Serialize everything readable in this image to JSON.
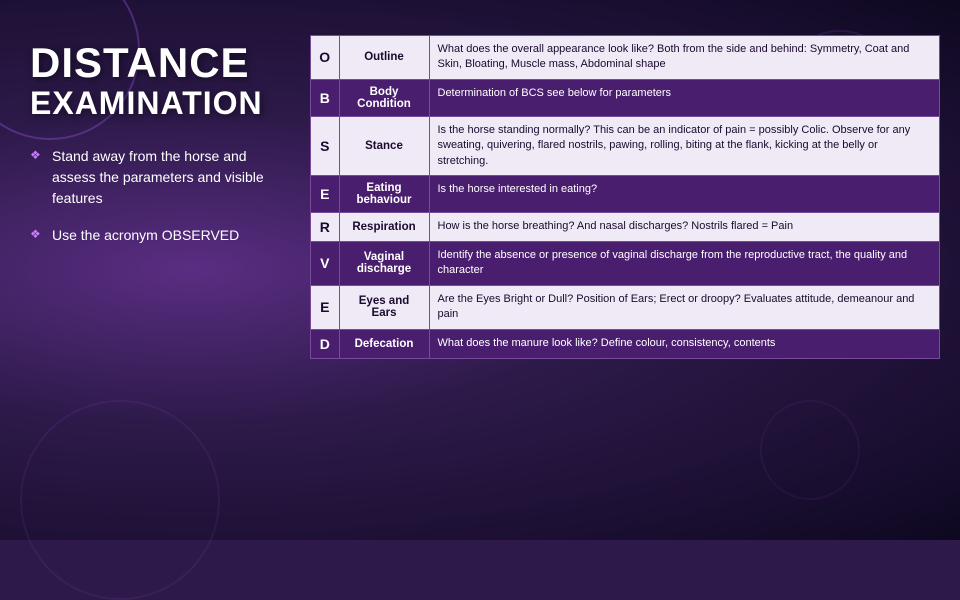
{
  "title": {
    "line1": "DISTANCE",
    "line2": "EXAMINATION"
  },
  "bullets": [
    {
      "text": "Stand away from the horse and assess the parameters and visible features"
    },
    {
      "text": "Use the acronym OBSERVED"
    }
  ],
  "table": {
    "rows": [
      {
        "letter": "O",
        "term": "Outline",
        "description": "What does the overall appearance look like? Both from the side and behind: Symmetry, Coat and Skin, Bloating, Muscle mass, Abdominal shape",
        "style": "light"
      },
      {
        "letter": "B",
        "term": "Body Condition",
        "description": "Determination of BCS see below for parameters",
        "style": "dark"
      },
      {
        "letter": "S",
        "term": "Stance",
        "description": "Is the horse standing normally? This can be an indicator of pain = possibly Colic. Observe for any sweating, quivering, flared nostrils, pawing, rolling, biting at the flank, kicking at the belly or stretching.",
        "style": "light"
      },
      {
        "letter": "E",
        "term": "Eating behaviour",
        "description": "Is the horse interested in eating?",
        "style": "dark"
      },
      {
        "letter": "R",
        "term": "Respiration",
        "description": "How is the horse breathing? And nasal discharges? Nostrils flared = Pain",
        "style": "light"
      },
      {
        "letter": "V",
        "term": "Vaginal discharge",
        "description": "Identify the absence or presence of vaginal discharge from the reproductive tract, the quality and character",
        "style": "dark"
      },
      {
        "letter": "E",
        "term": "Eyes and Ears",
        "description": "Are the Eyes Bright or Dull? Position of Ears; Erect or droopy? Evaluates attitude, demeanour and pain",
        "style": "light"
      },
      {
        "letter": "D",
        "term": "Defecation",
        "description": "What does the manure look like? Define colour, consistency, contents",
        "style": "dark"
      }
    ]
  }
}
